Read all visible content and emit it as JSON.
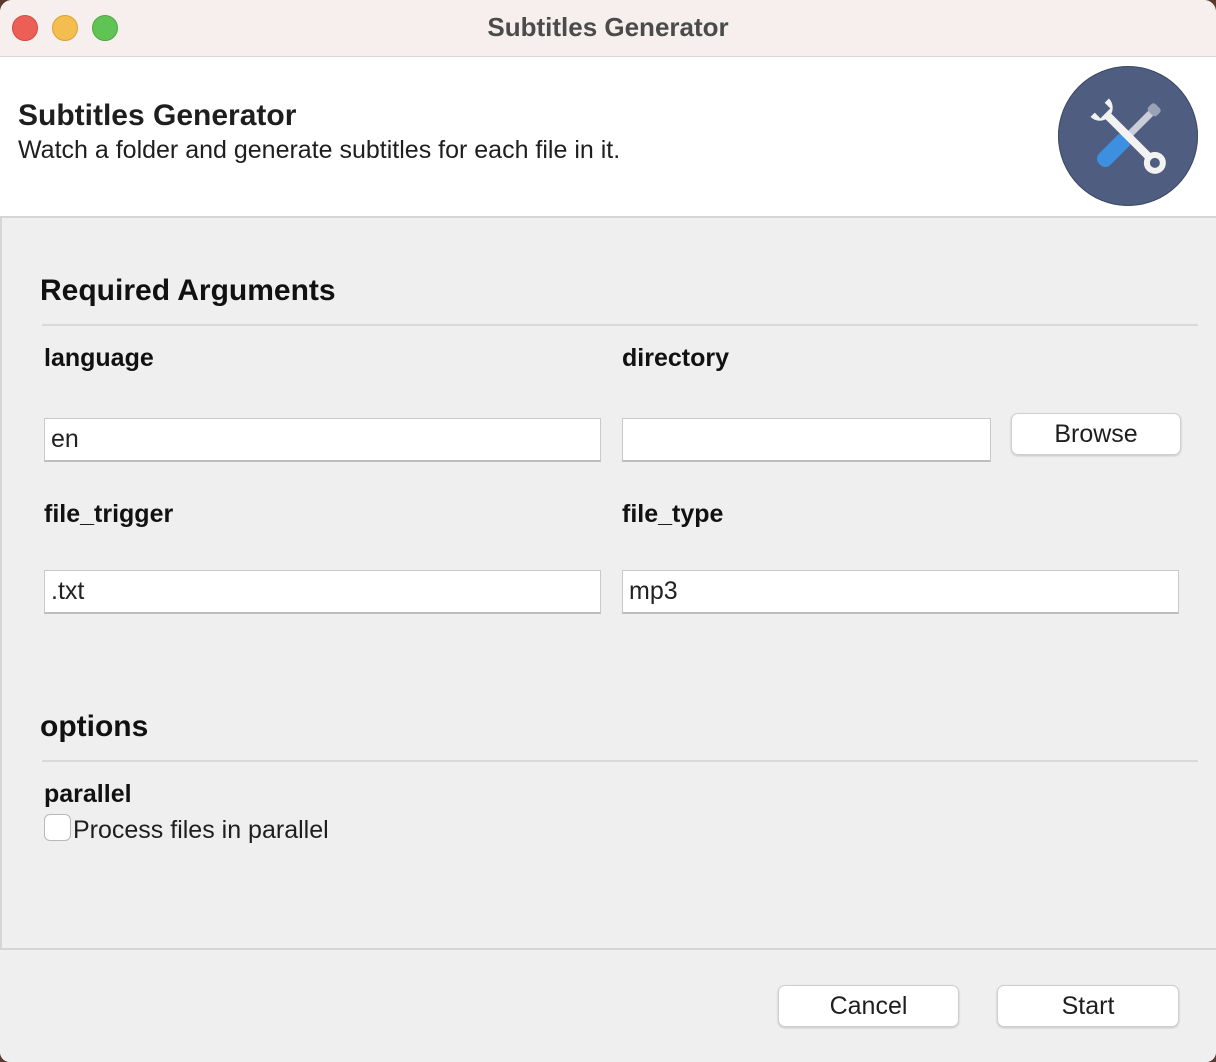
{
  "window": {
    "title": "Subtitles Generator"
  },
  "header": {
    "title": "Subtitles Generator",
    "subtitle": "Watch a folder and generate subtitles for each file in it.",
    "icon": "tools-icon",
    "icon_bg": "#4e5d80"
  },
  "required": {
    "section_title": "Required Arguments",
    "language": {
      "label": "language",
      "value": "en"
    },
    "directory": {
      "label": "directory",
      "value": "",
      "browse_label": "Browse"
    },
    "file_trigger": {
      "label": "file_trigger",
      "value": ".txt"
    },
    "file_type": {
      "label": "file_type",
      "value": "mp3"
    }
  },
  "options": {
    "section_title": "options",
    "parallel": {
      "label": "parallel",
      "checkbox_label": "Process files in parallel",
      "checked": false
    }
  },
  "footer": {
    "cancel_label": "Cancel",
    "start_label": "Start"
  },
  "colors": {
    "close": "#ec5f57",
    "minimize": "#f4bd4f",
    "maximize": "#60c454"
  }
}
